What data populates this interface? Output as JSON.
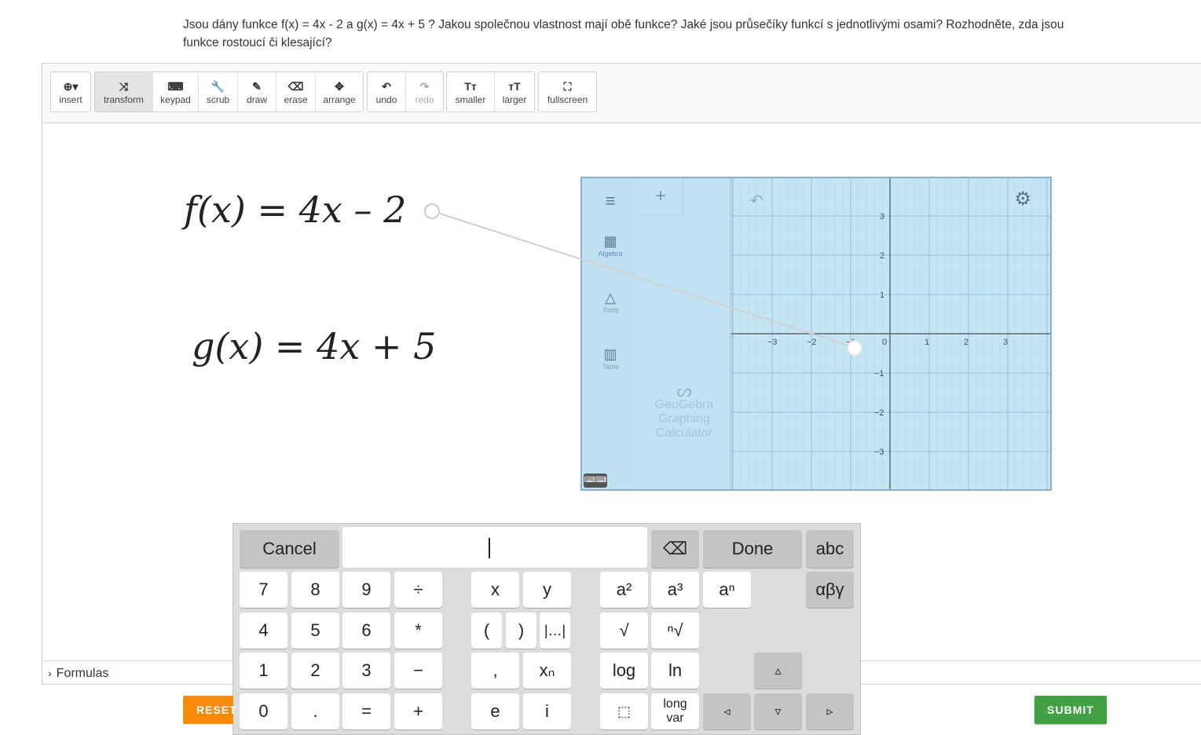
{
  "question": "Jsou dány funkce  f(x) = 4x - 2 a g(x) = 4x + 5 ? Jakou společnou vlastnost mají obě funkce? Jaké jsou průsečíky funkcí s jednotlivými osami? Rozhodněte, zda jsou funkce rostoucí či klesající?",
  "toolbar": {
    "insert": "insert",
    "transform": "transform",
    "keypad": "keypad",
    "scrub": "scrub",
    "draw": "draw",
    "erase": "erase",
    "arrange": "arrange",
    "undo": "undo",
    "redo": "redo",
    "smaller": "smaller",
    "larger": "larger",
    "fullscreen": "fullscreen",
    "icons": {
      "insert": "⊕▾",
      "transform": "⤨",
      "keypad": "⌨",
      "scrub": "🔧",
      "draw": "✎",
      "erase": "⌫",
      "arrange": "✥",
      "undo": "↶",
      "redo": "↷",
      "smaller": "Tт",
      "larger": "тT",
      "fullscreen": "⛶"
    }
  },
  "canvas": {
    "formula_f": "f(x) = 4x – 2",
    "formula_g": "g(x) = 4x + 5"
  },
  "geogebra": {
    "algebra_label": "Algebra",
    "tools_label": "Tools",
    "table_label": "Table",
    "menu_icon": "≡",
    "plus": "+",
    "undo": "↶",
    "gear": "⚙",
    "brand_line1": "GeoGebra",
    "brand_line2": "Graphing",
    "brand_line3": "Calculator",
    "x_ticks": [
      "−3",
      "−2",
      "−1",
      "0",
      "1",
      "2",
      "3"
    ],
    "y_ticks": [
      "3",
      "2",
      "1",
      "−1",
      "−2",
      "−3"
    ],
    "keyboard_icon": "⌨⌨"
  },
  "keypad": {
    "cancel": "Cancel",
    "backspace": "⌫",
    "done": "Done",
    "abc": "abc",
    "greek": "αβγ",
    "k7": "7",
    "k8": "8",
    "k9": "9",
    "div": "÷",
    "x": "x",
    "y": "y",
    "sq": "a²",
    "cube": "a³",
    "pow": "aⁿ",
    "k4": "4",
    "k5": "5",
    "k6": "6",
    "mul": "*",
    "lp": "(",
    "rp": ")",
    "abs": "|…|",
    "sqrt": "√",
    "nroot": "ⁿ√",
    "k1": "1",
    "k2": "2",
    "k3": "3",
    "minus": "−",
    "comma": ",",
    "xn": "xₙ",
    "log": "log",
    "ln": "ln",
    "up": "▵",
    "k0": "0",
    "dot": ".",
    "eq": "=",
    "plus": "+",
    "e": "e",
    "i": "i",
    "box": "⬚",
    "long1": "long",
    "long2": "var",
    "left": "◃",
    "down": "▿",
    "right": "▹"
  },
  "formulas": "Formulas",
  "reset": "RESET",
  "submit": "SUBMIT"
}
